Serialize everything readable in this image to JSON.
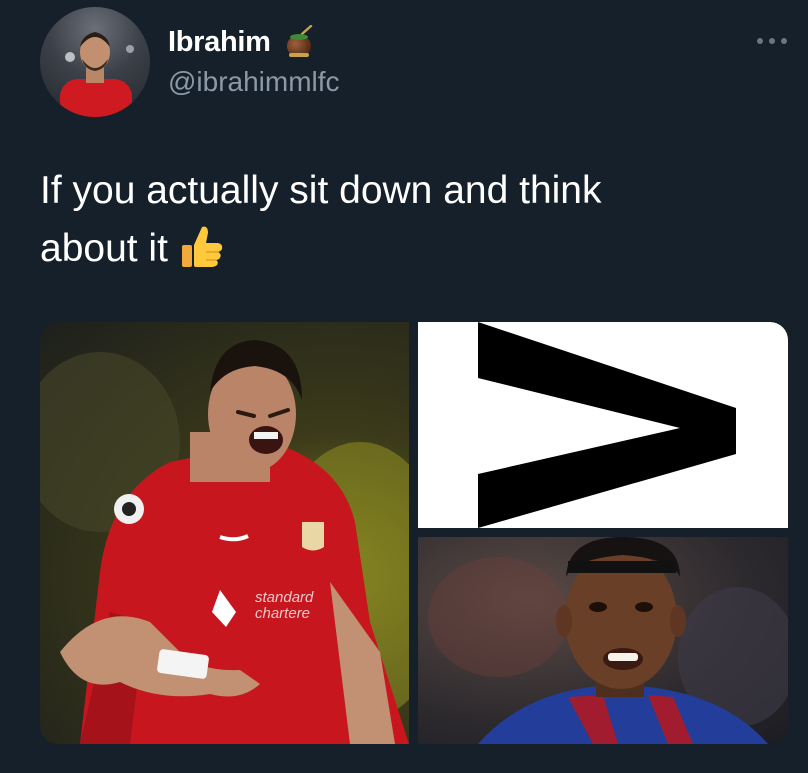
{
  "tweet": {
    "author": {
      "display_name": "Ibrahim",
      "handle": "@ibrahimmlfc",
      "avatar_icon": "avatar-photo",
      "name_emoji": "mate-cup-emoji"
    },
    "more_icon": "more-options-icon",
    "text": "If you actually sit down and think\nabout it",
    "text_emoji": "thumbs-up-emoji",
    "media": [
      {
        "icon": "photo-footballer-red-kit"
      },
      {
        "icon": "greater-than-symbol-image"
      },
      {
        "icon": "photo-footballer-smiling"
      }
    ],
    "colors": {
      "background": "#15202b",
      "text": "#ffffff",
      "secondary_text": "#8b98a5"
    }
  }
}
